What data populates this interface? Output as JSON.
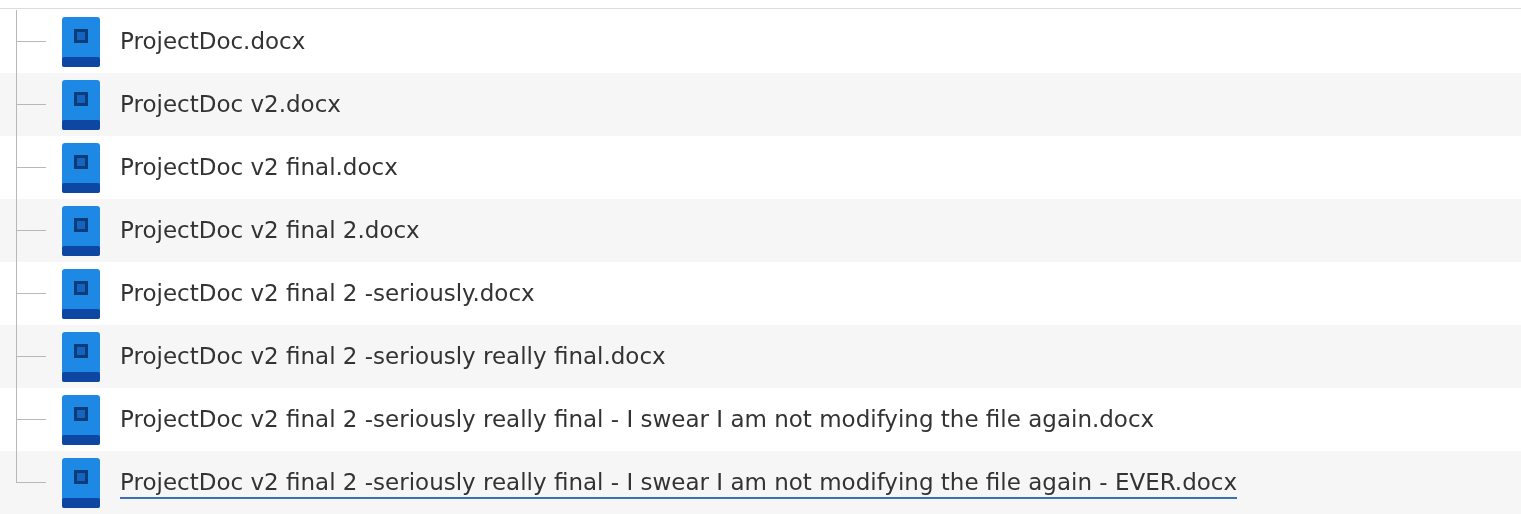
{
  "files": [
    {
      "name": "ProjectDoc.docx",
      "underlined": false
    },
    {
      "name": "ProjectDoc v2.docx",
      "underlined": false
    },
    {
      "name": "ProjectDoc v2 final.docx",
      "underlined": false
    },
    {
      "name": "ProjectDoc v2 final 2.docx",
      "underlined": false
    },
    {
      "name": "ProjectDoc v2 final 2 -seriously.docx",
      "underlined": false
    },
    {
      "name": "ProjectDoc v2 final 2 -seriously really final.docx",
      "underlined": false
    },
    {
      "name": "ProjectDoc v2 final 2 -seriously really final - I swear I am not modifying the file again.docx",
      "underlined": false
    },
    {
      "name": "ProjectDoc v2 final 2 -seriously really final - I swear I am not modifying the file again - EVER.docx",
      "underlined": true
    }
  ]
}
